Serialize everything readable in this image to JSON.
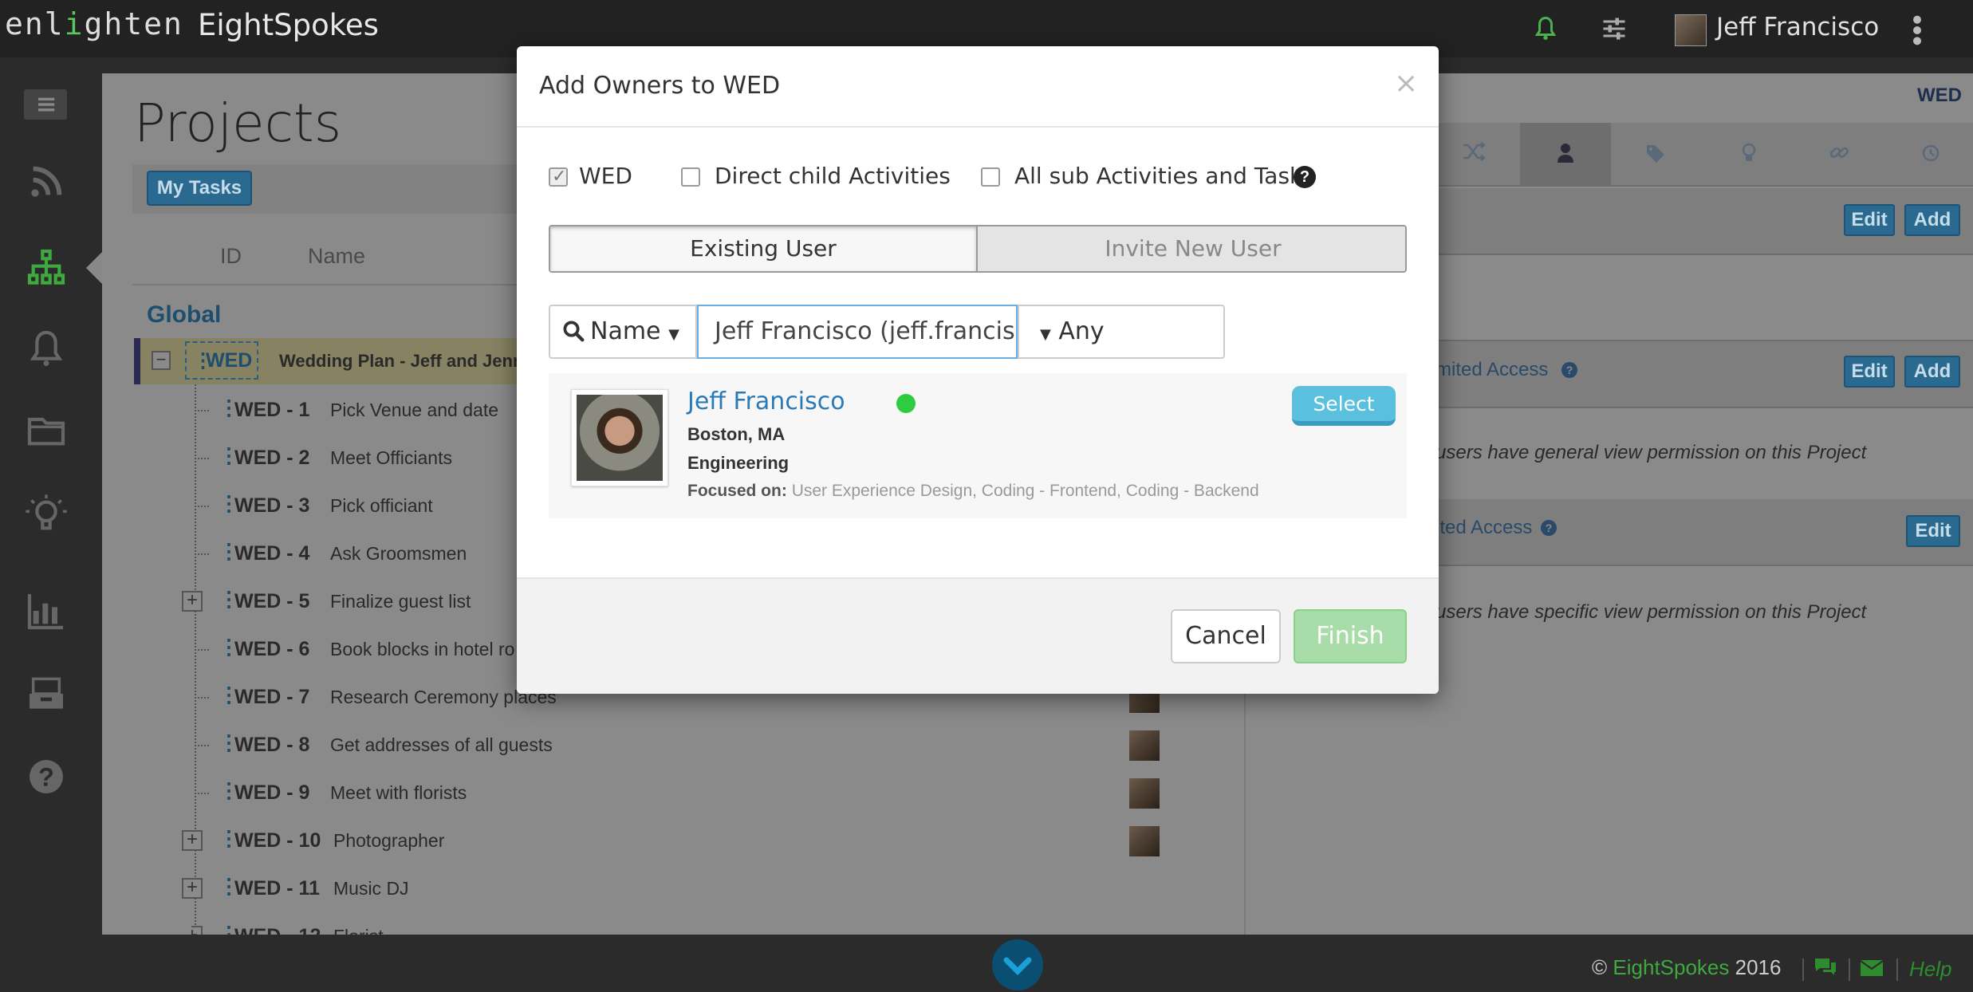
{
  "topbar": {
    "logo": "enlighten",
    "app_name": "EightSpokes",
    "user_name": "Jeff Francisco",
    "icons": [
      "bell-icon",
      "sliders-icon",
      "kebab-menu-icon"
    ]
  },
  "sidebar": {
    "icons": [
      "menu-toggle-icon",
      "feed-icon",
      "hierarchy-icon",
      "bell-icon",
      "folder-icon",
      "lightbulb-icon",
      "bar-chart-icon",
      "inbox-icon",
      "help-icon"
    ]
  },
  "main": {
    "title": "Projects",
    "my_tasks_label": "My Tasks",
    "col_id": "ID",
    "col_name": "Name",
    "group": "Global",
    "root": {
      "id": "WED",
      "name": "Wedding Plan - Jeff and Jenn"
    },
    "tasks": [
      {
        "id": "WED - 1",
        "name": "Pick Venue and date"
      },
      {
        "id": "WED - 2",
        "name": "Meet Officiants"
      },
      {
        "id": "WED - 3",
        "name": "Pick officiant"
      },
      {
        "id": "WED - 4",
        "name": "Ask Groomsmen"
      },
      {
        "id": "WED - 5",
        "name": "Finalize guest list"
      },
      {
        "id": "WED - 6",
        "name": "Book blocks in hotel ro"
      },
      {
        "id": "WED - 7",
        "name": "Research Ceremony places"
      },
      {
        "id": "WED - 8",
        "name": "Get addresses of all guests"
      },
      {
        "id": "WED - 9",
        "name": "Meet with florists"
      },
      {
        "id": "WED - 10",
        "name": "Photographer"
      },
      {
        "id": "WED - 11",
        "name": "Music DJ"
      },
      {
        "id": "WED - 12",
        "name": "Florist"
      }
    ]
  },
  "right_panel": {
    "project": "WED",
    "tabs": [
      "shuffle-icon",
      "user-icon",
      "tags-icon",
      "lightbulb-icon",
      "link-icon",
      "history-icon"
    ],
    "edit_label": "Edit",
    "add_label": "Add",
    "section_general": "mited Access",
    "general_desc": "users have general view permission on this Project",
    "section_specific": "ited Access",
    "specific_desc": "users have specific view permission on this Project"
  },
  "modal": {
    "title": "Add Owners to WED",
    "close": "×",
    "scope": {
      "wed": {
        "label": "WED",
        "checked": true
      },
      "direct": {
        "label": "Direct child Activities",
        "checked": false
      },
      "all": {
        "label": "All sub Activities and Tasks",
        "checked": false
      }
    },
    "help": "?",
    "tab_existing": "Existing User",
    "tab_invite": "Invite New User",
    "search_by": "Name",
    "search_value": "Jeff Francisco (jeff.francisco@eightspokes.com)",
    "company_filter": "Any Company",
    "result": {
      "name": "Jeff Francisco",
      "location": "Boston, MA",
      "department": "Engineering",
      "focus_label": "Focused on:",
      "focus": "User Experience Design, Coding - Frontend, Coding - Backend",
      "select_label": "Select"
    },
    "cancel_label": "Cancel",
    "finish_label": "Finish"
  },
  "footer": {
    "copyright": "©",
    "brand": "EightSpokes",
    "year": "2016",
    "help": "Help"
  },
  "colors": {
    "accent_blue": "#2a7ab8",
    "brand_green": "#3fa83f",
    "select_button": "#5bc0de",
    "finish_button": "#a8dca8"
  }
}
